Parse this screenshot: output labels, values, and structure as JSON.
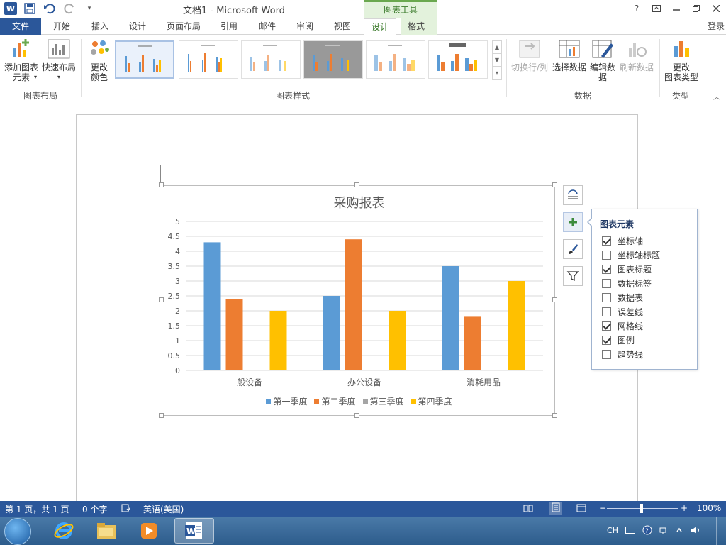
{
  "titlebar": {
    "app_logo": "W",
    "title": "文档1 - Microsoft Word",
    "contextual_label": "图表工具",
    "help": "?",
    "icons": [
      "word-logo-icon",
      "save-icon",
      "undo-icon",
      "redo-icon",
      "customize-qat-icon"
    ]
  },
  "tabs": {
    "file": "文件",
    "items": [
      "开始",
      "插入",
      "设计",
      "页面布局",
      "引用",
      "邮件",
      "审阅",
      "视图",
      "设计",
      "格式"
    ],
    "active_index": 8,
    "login": "登录"
  },
  "ribbon": {
    "add_element": "添加图表\n元素",
    "quick_layout": "快速布局",
    "group_layout": "图表布局",
    "change_colors": "更改\n颜色",
    "group_styles": "图表样式",
    "switch_row_col": "切换行/列",
    "select_data": "选择数据",
    "edit_data": "编辑数\n据",
    "refresh_data": "刷新数据",
    "group_data": "数据",
    "change_type": "更改\n图表类型",
    "group_type": "类型"
  },
  "chart_data": {
    "type": "bar",
    "title": "采购报表",
    "categories": [
      "一般设备",
      "办公设备",
      "消耗用品"
    ],
    "series": [
      {
        "name": "第一季度",
        "values": [
          4.3,
          2.5,
          3.5
        ],
        "color": "#5b9bd5"
      },
      {
        "name": "第二季度",
        "values": [
          2.4,
          4.4,
          1.8
        ],
        "color": "#ed7d31"
      },
      {
        "name": "第三季度",
        "values": [
          0,
          0,
          0
        ],
        "color": "#a5a5a5"
      },
      {
        "name": "第四季度",
        "values": [
          2.0,
          2.0,
          3.0
        ],
        "color": "#ffc000"
      }
    ],
    "ylim": [
      0,
      5
    ],
    "yticks": [
      "0",
      "0.5",
      "1",
      "1.5",
      "2",
      "2.5",
      "3",
      "3.5",
      "4",
      "4.5",
      "5"
    ],
    "grid": true,
    "legend_position": "bottom"
  },
  "flyout": {
    "title": "图表元素",
    "items": [
      {
        "label": "坐标轴",
        "checked": true
      },
      {
        "label": "坐标轴标题",
        "checked": false
      },
      {
        "label": "图表标题",
        "checked": true
      },
      {
        "label": "数据标签",
        "checked": false
      },
      {
        "label": "数据表",
        "checked": false
      },
      {
        "label": "误差线",
        "checked": false
      },
      {
        "label": "网格线",
        "checked": true
      },
      {
        "label": "图例",
        "checked": true
      },
      {
        "label": "趋势线",
        "checked": false
      }
    ]
  },
  "statusbar": {
    "page": "第 1 页，共 1 页",
    "words": "0 个字",
    "language": "英语(美国)",
    "zoom": "100%",
    "zoom_minus": "−",
    "zoom_plus": "+"
  },
  "taskbar": {
    "lang": "CH"
  }
}
